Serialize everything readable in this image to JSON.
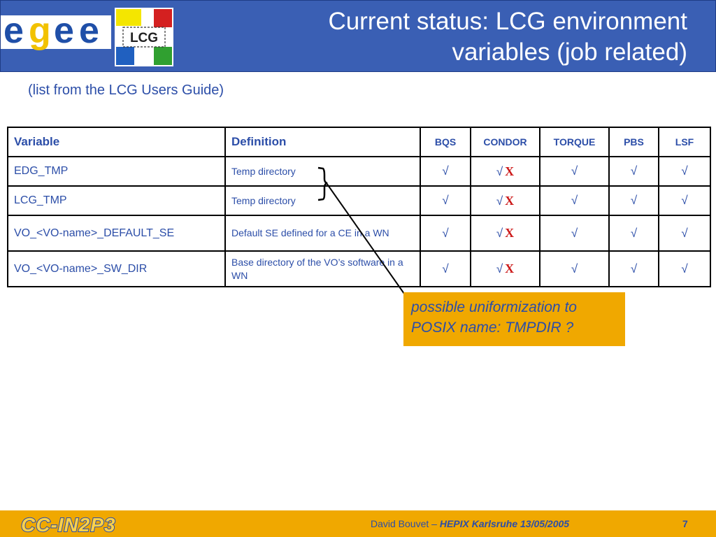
{
  "header": {
    "logo_egee": "egee",
    "logo_lcg": "LCG",
    "title_line1": "Current status: LCG environment",
    "title_line2": "variables (job related)"
  },
  "subtitle": "(list from the LCG Users Guide)",
  "table": {
    "headers": [
      "Variable",
      "Definition",
      "BQS",
      "CONDOR",
      "TORQUE",
      "PBS",
      "LSF"
    ],
    "check": "√",
    "cross": "X",
    "rows": [
      {
        "variable": "EDG_TMP",
        "definition": "Temp directory"
      },
      {
        "variable": "LCG_TMP",
        "definition": "Temp directory"
      },
      {
        "variable": "VO_<VO-name>_DEFAULT_SE",
        "definition": "Default SE defined for a CE in a WN"
      },
      {
        "variable": "VO_<VO-name>_SW_DIR",
        "definition": "Base directory of the VO’s software in a WN"
      }
    ]
  },
  "callout": {
    "line1": "possible uniformization to",
    "line2": "POSIX name: TMPDIR ?"
  },
  "footer": {
    "logo_text": "CC-IN2P3",
    "author": "David Bouvet – ",
    "event": "HEPIX Karlsruhe 13/05/2005",
    "page": "7"
  },
  "colors": {
    "header_bg": "#3a5fb4",
    "text_blue": "#2c4ea8",
    "accent_orange": "#f0a800",
    "cross_red": "#cc1a1a"
  }
}
